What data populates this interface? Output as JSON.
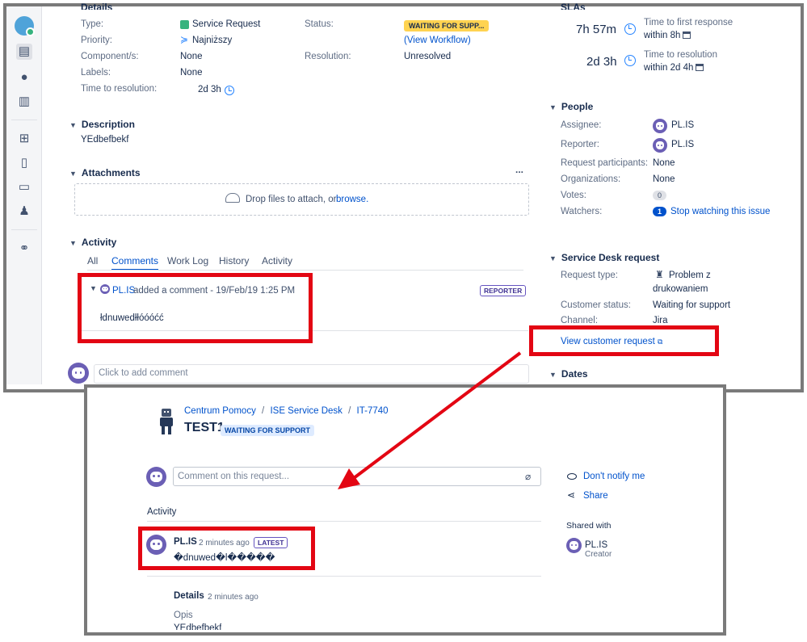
{
  "issue": {
    "details": {
      "heading": "Details",
      "type_label": "Type:",
      "type_value": "Service Request",
      "priority_label": "Priority:",
      "priority_value": "Najniższy",
      "components_label": "Component/s:",
      "components_value": "None",
      "labels_label": "Labels:",
      "labels_value": "None",
      "ttr_label": "Time to resolution:",
      "ttr_value": "2d 3h",
      "status_label": "Status:",
      "status_value": "WAITING FOR SUPP...",
      "view_workflow": "(View Workflow)",
      "resolution_label": "Resolution:",
      "resolution_value": "Unresolved"
    },
    "description": {
      "heading": "Description",
      "text": "YEdbefbekf"
    },
    "attachments": {
      "heading": "Attachments",
      "more": "...",
      "drop_text": "Drop files to attach, or",
      "browse": "browse."
    },
    "activity": {
      "heading": "Activity",
      "tabs": [
        "All",
        "Comments",
        "Work Log",
        "History",
        "Activity"
      ],
      "comment_author": "PL.IS",
      "comment_meta": "added a comment - 19/Feb/19 1:25 PM",
      "comment_badge": "REPORTER",
      "comment_text": "łdnuwedłłóóóćć",
      "add_comment_placeholder": "Click to add comment"
    },
    "sla": {
      "heading": "SLAs",
      "items": [
        {
          "time": "7h 57m",
          "title": "Time to first response",
          "sub": "within 8h"
        },
        {
          "time": "2d 3h",
          "title": "Time to resolution",
          "sub": "within 2d 4h"
        }
      ]
    },
    "people": {
      "heading": "People",
      "assignee_label": "Assignee:",
      "assignee_value": "PL.IS",
      "reporter_label": "Reporter:",
      "reporter_value": "PL.IS",
      "participants_label": "Request participants:",
      "participants_value": "None",
      "organizations_label": "Organizations:",
      "organizations_value": "None",
      "votes_label": "Votes:",
      "votes_value": "0",
      "watchers_label": "Watchers:",
      "watchers_count": "1",
      "watchers_link": "Stop watching this issue"
    },
    "sd_request": {
      "heading": "Service Desk request",
      "request_type_label": "Request type:",
      "request_type_value_1": "Problem z",
      "request_type_value_2": "drukowaniem",
      "customer_status_label": "Customer status:",
      "customer_status_value": "Waiting for support",
      "channel_label": "Channel:",
      "channel_value": "Jira",
      "view_customer_request": "View customer request"
    },
    "dates": {
      "heading": "Dates"
    }
  },
  "portal": {
    "breadcrumb": [
      "Centrum Pomocy",
      "ISE Service Desk",
      "IT-7740"
    ],
    "title": "TEST1",
    "status": "WAITING FOR SUPPORT",
    "comment_placeholder": "Comment on this request...",
    "dont_notify": "Don't notify me",
    "share": "Share",
    "activity_heading": "Activity",
    "comment_author": "PL.IS",
    "comment_time": "2 minutes ago",
    "comment_badge": "LATEST",
    "comment_text": "�dnuwed�l�����",
    "shared_with_heading": "Shared with",
    "shared_name": "PL.IS",
    "shared_role": "Creator",
    "details_heading": "Details",
    "details_time": "2 minutes ago",
    "opis_label": "Opis",
    "opis_value": "YEdbefbekf"
  },
  "colors": {
    "annotation_red": "#e30613",
    "frame_gray": "#7a7a7a",
    "link_blue": "#0052cc"
  }
}
